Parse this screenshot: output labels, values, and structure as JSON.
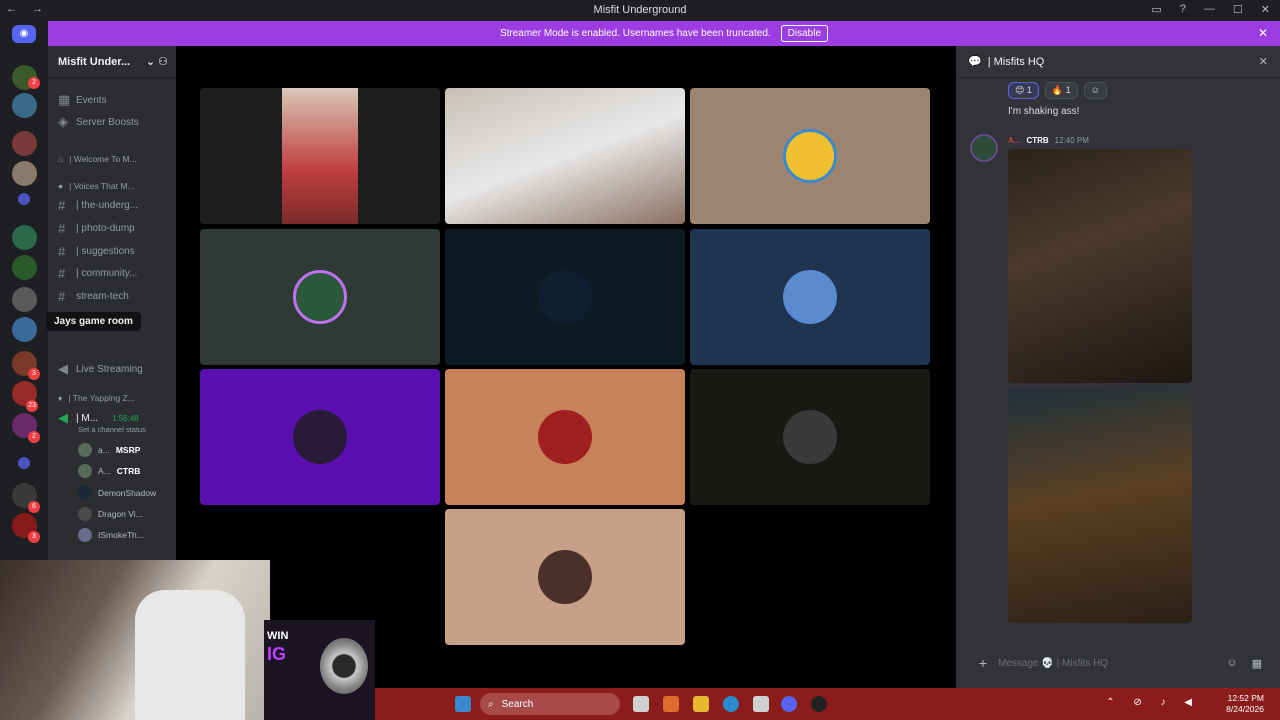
{
  "window": {
    "title": "Misfit Underground"
  },
  "banner": {
    "text": "Streamer Mode is enabled. Usernames have been truncated.",
    "button": "Disable"
  },
  "server": {
    "name": "Misfit Under...",
    "items": [
      {
        "label": "Events"
      },
      {
        "label": "Server Boosts"
      }
    ],
    "categories": [
      {
        "label": "| Welcome To M..."
      },
      {
        "label": "| Voices That M..."
      },
      {
        "label": "| The Yapping Z..."
      }
    ],
    "channels": [
      {
        "label": "| the-underg..."
      },
      {
        "label": "| photo-dump"
      },
      {
        "label": "| suggestions"
      },
      {
        "label": "| community..."
      },
      {
        "label": "stream-tech"
      },
      {
        "label": "Live Streaming"
      }
    ],
    "voice_channel": {
      "name": "| M...",
      "timer": "1:56:48",
      "status": "Set a channel status"
    },
    "voice_users": [
      {
        "name": "a...",
        "tag": "MSRP"
      },
      {
        "name": "A...",
        "tag": "CTRB"
      },
      {
        "name": "DemonShadow"
      },
      {
        "name": "Dragon Vi..."
      },
      {
        "name": "ISmokeTh..."
      }
    ],
    "tooltip": "Jays game room"
  },
  "rail": {
    "badges": [
      "2",
      "3",
      "23",
      "2",
      "6",
      "3",
      "3"
    ]
  },
  "chat": {
    "header": "| Misfits HQ",
    "reactions": [
      {
        "emoji": "😊",
        "count": "1"
      },
      {
        "emoji": "🔥",
        "count": "1"
      }
    ],
    "message_text": "I'm shaking ass!",
    "author": "A...",
    "author_tag": "CTRB",
    "time": "12:40 PM",
    "composer_placeholder": "Message 💀 | Misfits HQ"
  },
  "taskbar": {
    "search": "Search",
    "time": "12:52 PM",
    "date": "8/24/2026"
  },
  "ad": {
    "line1": "WIN",
    "line2": "IG"
  },
  "colors": {
    "accent": "#5865f2",
    "banner": "#9b3de0",
    "taskbar": "#8a1c1c"
  }
}
